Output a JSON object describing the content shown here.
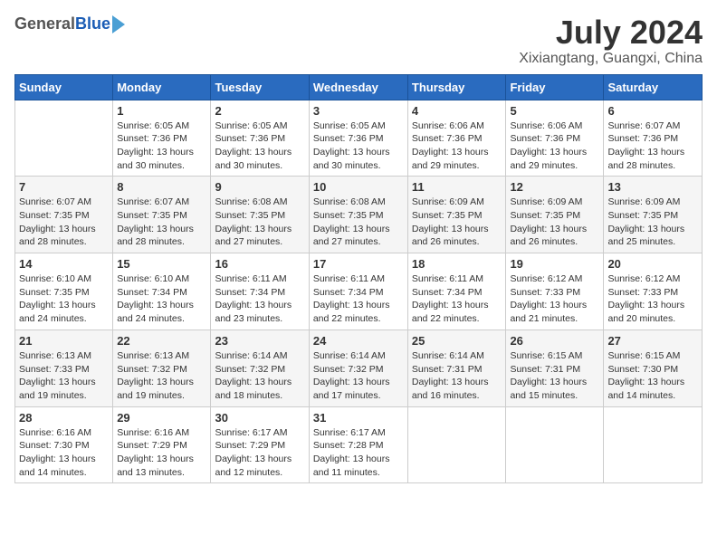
{
  "logo": {
    "general": "General",
    "blue": "Blue"
  },
  "title": "July 2024",
  "subtitle": "Xixiangtang, Guangxi, China",
  "days_of_week": [
    "Sunday",
    "Monday",
    "Tuesday",
    "Wednesday",
    "Thursday",
    "Friday",
    "Saturday"
  ],
  "weeks": [
    [
      {
        "day": "",
        "sunrise": "",
        "sunset": "",
        "daylight": ""
      },
      {
        "day": "1",
        "sunrise": "Sunrise: 6:05 AM",
        "sunset": "Sunset: 7:36 PM",
        "daylight": "Daylight: 13 hours and 30 minutes."
      },
      {
        "day": "2",
        "sunrise": "Sunrise: 6:05 AM",
        "sunset": "Sunset: 7:36 PM",
        "daylight": "Daylight: 13 hours and 30 minutes."
      },
      {
        "day": "3",
        "sunrise": "Sunrise: 6:05 AM",
        "sunset": "Sunset: 7:36 PM",
        "daylight": "Daylight: 13 hours and 30 minutes."
      },
      {
        "day": "4",
        "sunrise": "Sunrise: 6:06 AM",
        "sunset": "Sunset: 7:36 PM",
        "daylight": "Daylight: 13 hours and 29 minutes."
      },
      {
        "day": "5",
        "sunrise": "Sunrise: 6:06 AM",
        "sunset": "Sunset: 7:36 PM",
        "daylight": "Daylight: 13 hours and 29 minutes."
      },
      {
        "day": "6",
        "sunrise": "Sunrise: 6:07 AM",
        "sunset": "Sunset: 7:36 PM",
        "daylight": "Daylight: 13 hours and 28 minutes."
      }
    ],
    [
      {
        "day": "7",
        "sunrise": "Sunrise: 6:07 AM",
        "sunset": "Sunset: 7:35 PM",
        "daylight": "Daylight: 13 hours and 28 minutes."
      },
      {
        "day": "8",
        "sunrise": "Sunrise: 6:07 AM",
        "sunset": "Sunset: 7:35 PM",
        "daylight": "Daylight: 13 hours and 28 minutes."
      },
      {
        "day": "9",
        "sunrise": "Sunrise: 6:08 AM",
        "sunset": "Sunset: 7:35 PM",
        "daylight": "Daylight: 13 hours and 27 minutes."
      },
      {
        "day": "10",
        "sunrise": "Sunrise: 6:08 AM",
        "sunset": "Sunset: 7:35 PM",
        "daylight": "Daylight: 13 hours and 27 minutes."
      },
      {
        "day": "11",
        "sunrise": "Sunrise: 6:09 AM",
        "sunset": "Sunset: 7:35 PM",
        "daylight": "Daylight: 13 hours and 26 minutes."
      },
      {
        "day": "12",
        "sunrise": "Sunrise: 6:09 AM",
        "sunset": "Sunset: 7:35 PM",
        "daylight": "Daylight: 13 hours and 26 minutes."
      },
      {
        "day": "13",
        "sunrise": "Sunrise: 6:09 AM",
        "sunset": "Sunset: 7:35 PM",
        "daylight": "Daylight: 13 hours and 25 minutes."
      }
    ],
    [
      {
        "day": "14",
        "sunrise": "Sunrise: 6:10 AM",
        "sunset": "Sunset: 7:35 PM",
        "daylight": "Daylight: 13 hours and 24 minutes."
      },
      {
        "day": "15",
        "sunrise": "Sunrise: 6:10 AM",
        "sunset": "Sunset: 7:34 PM",
        "daylight": "Daylight: 13 hours and 24 minutes."
      },
      {
        "day": "16",
        "sunrise": "Sunrise: 6:11 AM",
        "sunset": "Sunset: 7:34 PM",
        "daylight": "Daylight: 13 hours and 23 minutes."
      },
      {
        "day": "17",
        "sunrise": "Sunrise: 6:11 AM",
        "sunset": "Sunset: 7:34 PM",
        "daylight": "Daylight: 13 hours and 22 minutes."
      },
      {
        "day": "18",
        "sunrise": "Sunrise: 6:11 AM",
        "sunset": "Sunset: 7:34 PM",
        "daylight": "Daylight: 13 hours and 22 minutes."
      },
      {
        "day": "19",
        "sunrise": "Sunrise: 6:12 AM",
        "sunset": "Sunset: 7:33 PM",
        "daylight": "Daylight: 13 hours and 21 minutes."
      },
      {
        "day": "20",
        "sunrise": "Sunrise: 6:12 AM",
        "sunset": "Sunset: 7:33 PM",
        "daylight": "Daylight: 13 hours and 20 minutes."
      }
    ],
    [
      {
        "day": "21",
        "sunrise": "Sunrise: 6:13 AM",
        "sunset": "Sunset: 7:33 PM",
        "daylight": "Daylight: 13 hours and 19 minutes."
      },
      {
        "day": "22",
        "sunrise": "Sunrise: 6:13 AM",
        "sunset": "Sunset: 7:32 PM",
        "daylight": "Daylight: 13 hours and 19 minutes."
      },
      {
        "day": "23",
        "sunrise": "Sunrise: 6:14 AM",
        "sunset": "Sunset: 7:32 PM",
        "daylight": "Daylight: 13 hours and 18 minutes."
      },
      {
        "day": "24",
        "sunrise": "Sunrise: 6:14 AM",
        "sunset": "Sunset: 7:32 PM",
        "daylight": "Daylight: 13 hours and 17 minutes."
      },
      {
        "day": "25",
        "sunrise": "Sunrise: 6:14 AM",
        "sunset": "Sunset: 7:31 PM",
        "daylight": "Daylight: 13 hours and 16 minutes."
      },
      {
        "day": "26",
        "sunrise": "Sunrise: 6:15 AM",
        "sunset": "Sunset: 7:31 PM",
        "daylight": "Daylight: 13 hours and 15 minutes."
      },
      {
        "day": "27",
        "sunrise": "Sunrise: 6:15 AM",
        "sunset": "Sunset: 7:30 PM",
        "daylight": "Daylight: 13 hours and 14 minutes."
      }
    ],
    [
      {
        "day": "28",
        "sunrise": "Sunrise: 6:16 AM",
        "sunset": "Sunset: 7:30 PM",
        "daylight": "Daylight: 13 hours and 14 minutes."
      },
      {
        "day": "29",
        "sunrise": "Sunrise: 6:16 AM",
        "sunset": "Sunset: 7:29 PM",
        "daylight": "Daylight: 13 hours and 13 minutes."
      },
      {
        "day": "30",
        "sunrise": "Sunrise: 6:17 AM",
        "sunset": "Sunset: 7:29 PM",
        "daylight": "Daylight: 13 hours and 12 minutes."
      },
      {
        "day": "31",
        "sunrise": "Sunrise: 6:17 AM",
        "sunset": "Sunset: 7:28 PM",
        "daylight": "Daylight: 13 hours and 11 minutes."
      },
      {
        "day": "",
        "sunrise": "",
        "sunset": "",
        "daylight": ""
      },
      {
        "day": "",
        "sunrise": "",
        "sunset": "",
        "daylight": ""
      },
      {
        "day": "",
        "sunrise": "",
        "sunset": "",
        "daylight": ""
      }
    ]
  ]
}
